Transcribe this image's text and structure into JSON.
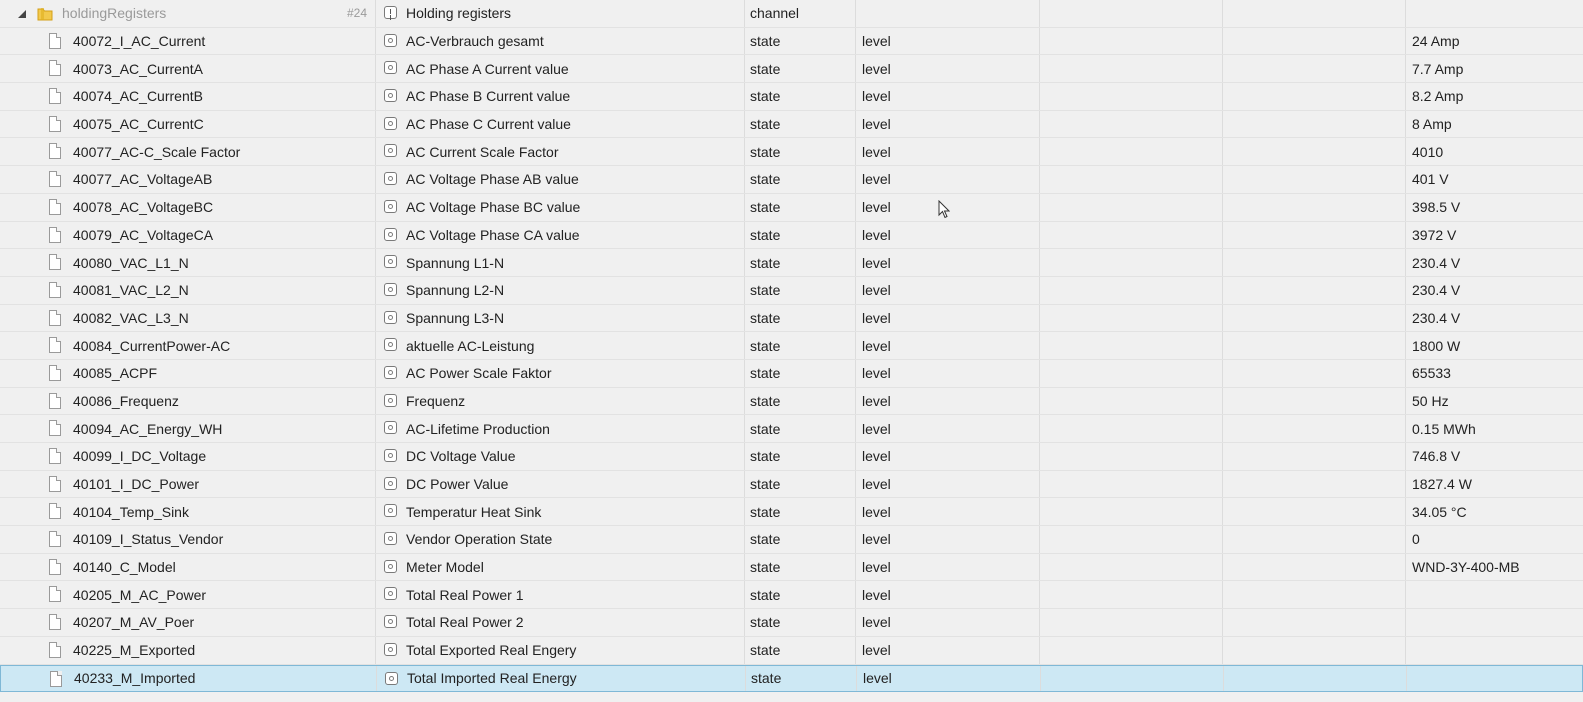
{
  "folder": {
    "name": "holdingRegisters",
    "count": "#24",
    "title": "Holding registers",
    "type": "channel"
  },
  "rows": [
    {
      "id": "40072_I_AC_Current",
      "name": "AC-Verbrauch gesamt",
      "type": "state",
      "role": "level",
      "value": "24 Amp"
    },
    {
      "id": "40073_AC_CurrentA",
      "name": "AC Phase A Current value",
      "type": "state",
      "role": "level",
      "value": "7.7 Amp"
    },
    {
      "id": "40074_AC_CurrentB",
      "name": "AC Phase B Current value",
      "type": "state",
      "role": "level",
      "value": "8.2 Amp"
    },
    {
      "id": "40075_AC_CurrentC",
      "name": "AC Phase C Current value",
      "type": "state",
      "role": "level",
      "value": "8 Amp"
    },
    {
      "id": "40077_AC-C_Scale Factor",
      "name": "AC Current Scale Factor",
      "type": "state",
      "role": "level",
      "value": "4010"
    },
    {
      "id": "40077_AC_VoltageAB",
      "name": "AC Voltage Phase AB value",
      "type": "state",
      "role": "level",
      "value": "401 V"
    },
    {
      "id": "40078_AC_VoltageBC",
      "name": "AC Voltage Phase BC value",
      "type": "state",
      "role": "level",
      "value": "398.5 V"
    },
    {
      "id": "40079_AC_VoltageCA",
      "name": "AC Voltage Phase CA value",
      "type": "state",
      "role": "level",
      "value": "3972 V"
    },
    {
      "id": "40080_VAC_L1_N",
      "name": "Spannung L1-N",
      "type": "state",
      "role": "level",
      "value": "230.4 V"
    },
    {
      "id": "40081_VAC_L2_N",
      "name": "Spannung L2-N",
      "type": "state",
      "role": "level",
      "value": "230.4 V"
    },
    {
      "id": "40082_VAC_L3_N",
      "name": "Spannung L3-N",
      "type": "state",
      "role": "level",
      "value": "230.4 V"
    },
    {
      "id": "40084_CurrentPower-AC",
      "name": "aktuelle AC-Leistung",
      "type": "state",
      "role": "level",
      "value": "1800 W"
    },
    {
      "id": "40085_ACPF",
      "name": "AC Power Scale Faktor",
      "type": "state",
      "role": "level",
      "value": "65533"
    },
    {
      "id": "40086_Frequenz",
      "name": "Frequenz",
      "type": "state",
      "role": "level",
      "value": "50 Hz"
    },
    {
      "id": "40094_AC_Energy_WH",
      "name": "AC-Lifetime Production",
      "type": "state",
      "role": "level",
      "value": "0.15 MWh"
    },
    {
      "id": "40099_I_DC_Voltage",
      "name": "DC Voltage Value",
      "type": "state",
      "role": "level",
      "value": "746.8 V"
    },
    {
      "id": "40101_I_DC_Power",
      "name": "DC Power Value",
      "type": "state",
      "role": "level",
      "value": "1827.4 W"
    },
    {
      "id": "40104_Temp_Sink",
      "name": "Temperatur Heat Sink",
      "type": "state",
      "role": "level",
      "value": "34.05 °C"
    },
    {
      "id": "40109_I_Status_Vendor",
      "name": "Vendor Operation State",
      "type": "state",
      "role": "level",
      "value": "0"
    },
    {
      "id": "40140_C_Model",
      "name": "Meter Model",
      "type": "state",
      "role": "level",
      "value": "WND-3Y-400-MB"
    },
    {
      "id": "40205_M_AC_Power",
      "name": "Total Real Power 1",
      "type": "state",
      "role": "level",
      "value": ""
    },
    {
      "id": "40207_M_AV_Poer",
      "name": "Total Real Power 2",
      "type": "state",
      "role": "level",
      "value": ""
    },
    {
      "id": "40225_M_Exported",
      "name": "Total Exported Real Engery",
      "type": "state",
      "role": "level",
      "value": ""
    },
    {
      "id": "40233_M_Imported",
      "name": "Total Imported Real Energy",
      "type": "state",
      "role": "level",
      "value": "",
      "selected": true
    }
  ]
}
